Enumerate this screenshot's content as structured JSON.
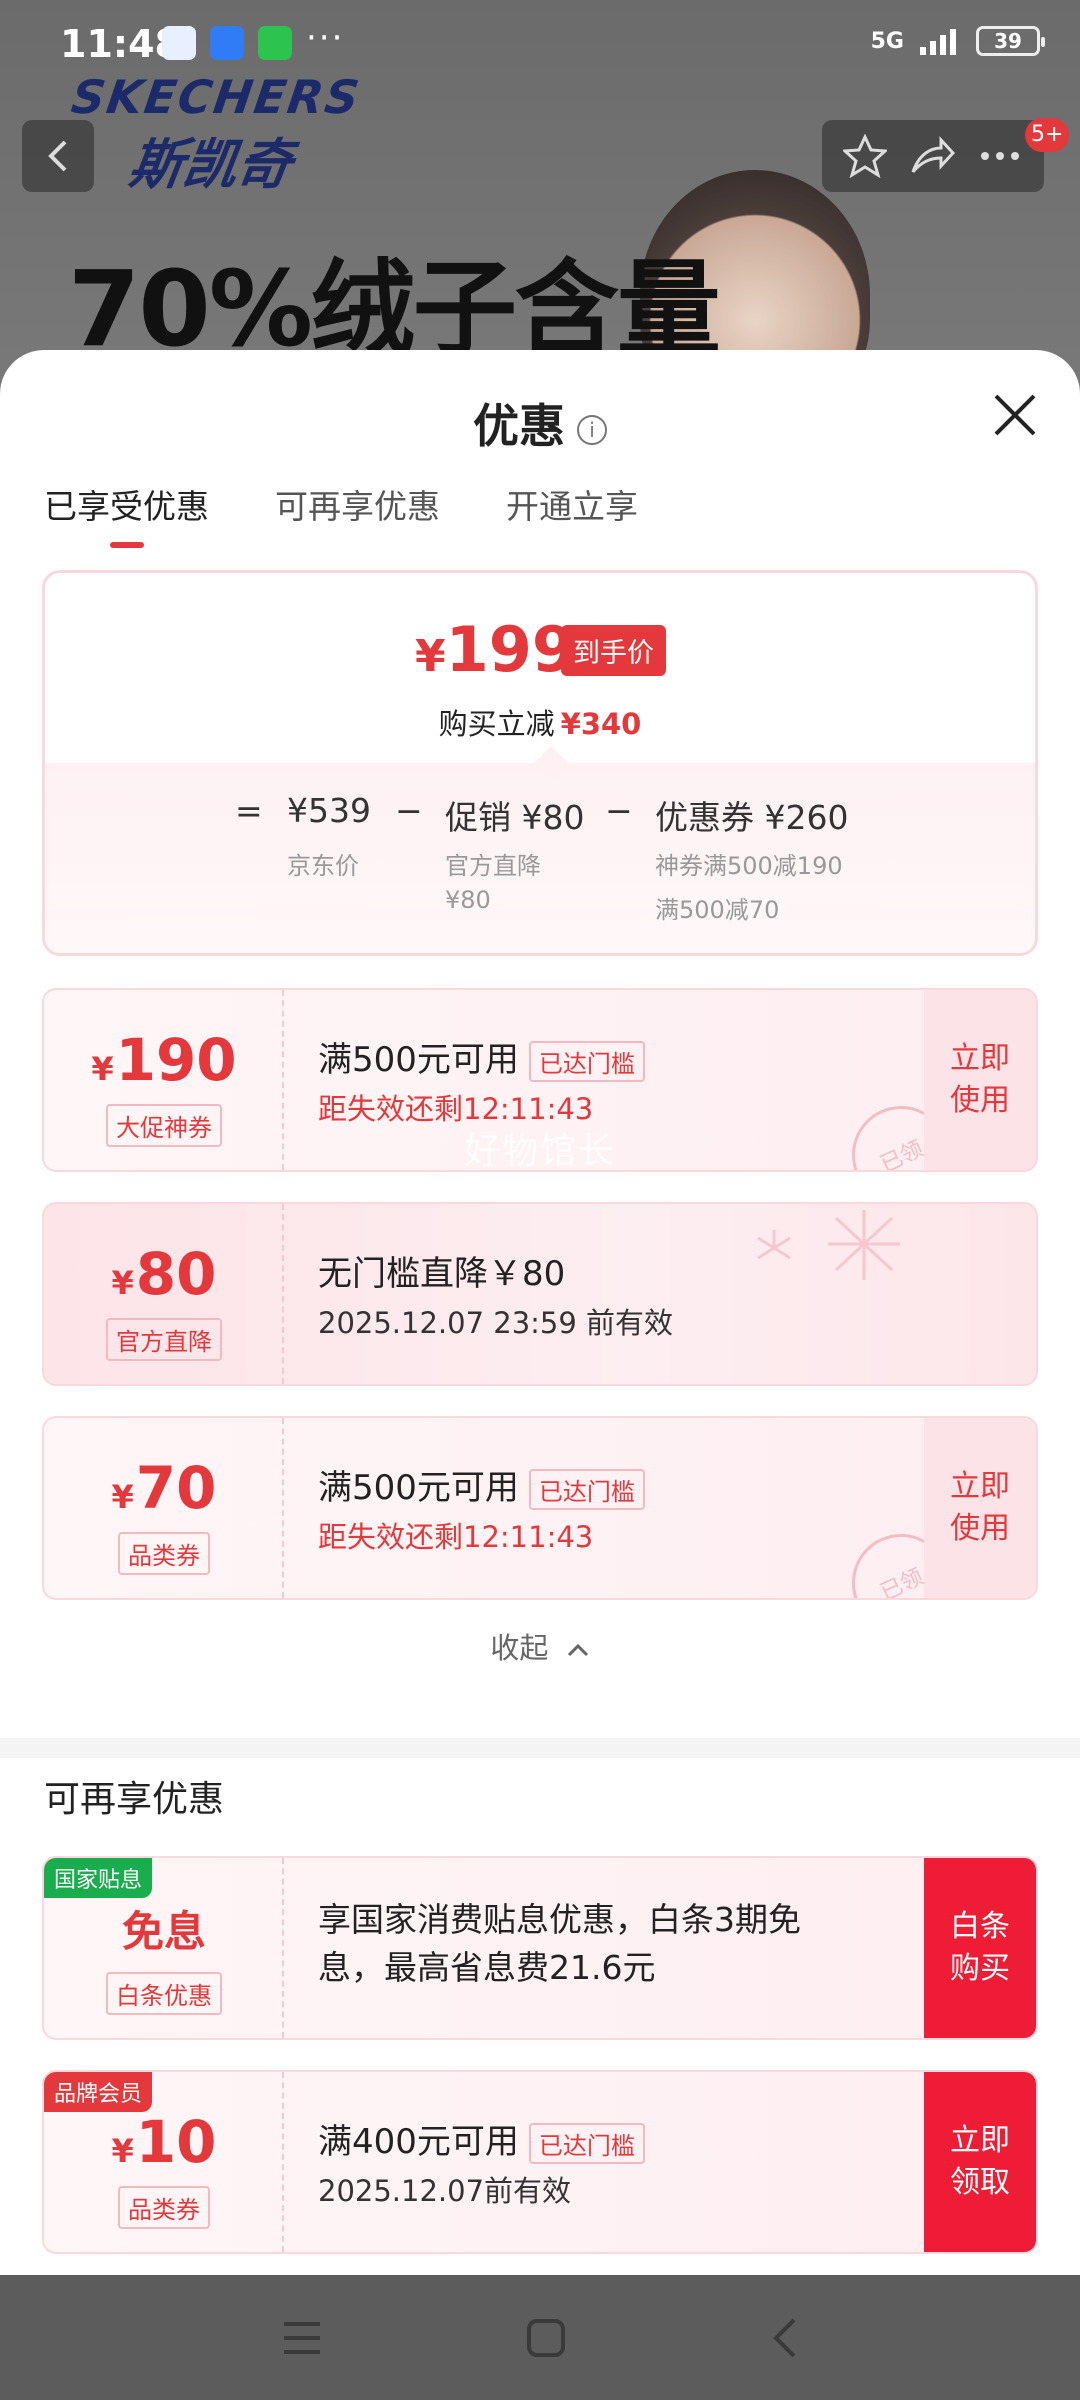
{
  "status_bar": {
    "time": "11:48",
    "network": "5G",
    "battery": "39"
  },
  "background": {
    "brand_en": "SKECHERS",
    "brand_cn": "斯凯奇",
    "headline": "70%绒子含量",
    "message_badge": "5+"
  },
  "sheet": {
    "title": "优惠",
    "tabs": [
      {
        "label": "已享受优惠"
      },
      {
        "label": "可再享优惠"
      },
      {
        "label": "开通立享"
      }
    ],
    "summary": {
      "final_price": "199",
      "currency": "¥",
      "final_tag": "到手价",
      "instant_label": "购买立减",
      "instant_amount": "¥340",
      "calc": {
        "equals": "=",
        "minus": "−",
        "jd_price": "¥539",
        "jd_price_label": "京东价",
        "promo": "促销 ¥80",
        "promo_note1": "官方直降",
        "promo_note2": "¥80",
        "coupon": "优惠券 ¥260",
        "coupon_note1": "神券满500减190",
        "coupon_note2": "满500减70"
      }
    },
    "coupons": [
      {
        "amount": "190",
        "type": "大促神券",
        "condition": "满500元可用",
        "badge": "已达门槛",
        "note": "距失效还剩12:11:43",
        "action": "立即使用",
        "stamp": "已领",
        "watermark": "好物馆长"
      },
      {
        "amount": "80",
        "type": "官方直降",
        "condition": "无门槛直降￥80",
        "note": "2025.12.07 23:59 前有效"
      },
      {
        "amount": "70",
        "type": "品类券",
        "condition": "满500元可用",
        "badge": "已达门槛",
        "note": "距失效还剩12:11:43",
        "action": "立即使用",
        "stamp": "已领"
      }
    ],
    "collapse_label": "收起",
    "more_section_title": "可再享优惠",
    "more_offers": [
      {
        "corner_tag": "国家贴息",
        "amount_text": "免息",
        "type": "白条优惠",
        "desc_line1": "享国家消费贴息优惠，白条3期免",
        "desc_line2": "息，最高省息费21.6元",
        "action": "白条购买"
      },
      {
        "corner_tag": "品牌会员",
        "amount": "10",
        "type": "品类券",
        "condition": "满400元可用",
        "badge": "已达门槛",
        "note": "2025.12.07前有效",
        "action": "立即领取"
      }
    ]
  },
  "colors": {
    "accent": "#e4393c",
    "sheet_bg": "#ffffff",
    "coupon_bg": "#fdeef1",
    "gov_tag": "#1aad4e"
  }
}
